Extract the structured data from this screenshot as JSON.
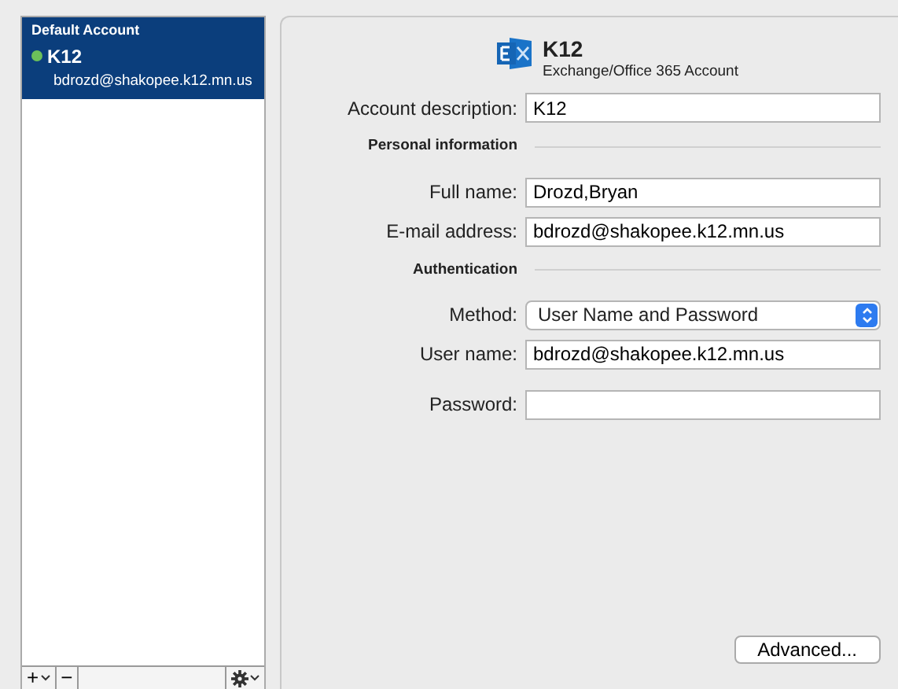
{
  "sidebar": {
    "group_label": "Default Account",
    "accounts": [
      {
        "name": "K12",
        "email": "bdrozd@shakopee.k12.mn.us",
        "selected": true,
        "color": "#6cc05a"
      }
    ],
    "toolbar": {
      "add": "+",
      "remove": "−"
    }
  },
  "account": {
    "name": "K12",
    "type": "Exchange/Office 365 Account",
    "fields": [
      {
        "kind": "input",
        "label": "Account description:",
        "value": "K12"
      },
      {
        "kind": "section",
        "label": "Personal information"
      },
      {
        "kind": "input",
        "label": "Full name:",
        "value": "Drozd,Bryan"
      },
      {
        "kind": "input",
        "label": "E-mail address:",
        "value": "bdrozd@shakopee.k12.mn.us"
      },
      {
        "kind": "section",
        "label": "Authentication"
      },
      {
        "kind": "select",
        "label": "Method:",
        "value": "User Name and Password"
      },
      {
        "kind": "input",
        "label": "User name:",
        "value": "bdrozd@shakopee.k12.mn.us"
      },
      {
        "kind": "password",
        "label": "Password:"
      }
    ],
    "advanced_button": "Advanced..."
  }
}
